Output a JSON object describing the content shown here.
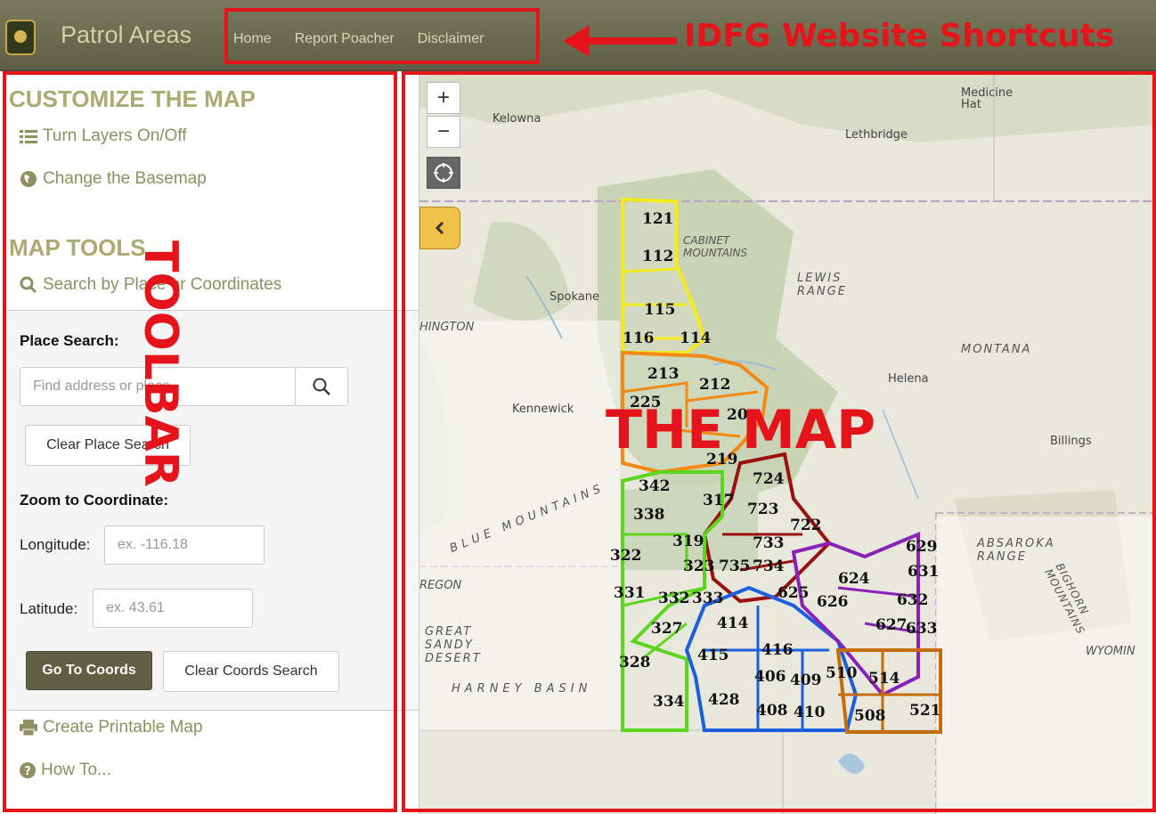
{
  "header": {
    "title": "Patrol Areas",
    "nav": [
      "Home",
      "Report Poacher",
      "Disclaimer"
    ]
  },
  "annotations": {
    "shortcuts": "IDFG Website Shortcuts",
    "toolbar": "TOOLBAR",
    "map": "THE MAP",
    "color": "#e5141a"
  },
  "sidebar": {
    "customize_heading": "CUSTOMIZE THE MAP",
    "layers_link": "Turn Layers On/Off",
    "basemap_link": "Change the Basemap",
    "tools_heading": "MAP TOOLS",
    "search_link": "Search by Place or Coordinates",
    "place_search_label": "Place Search:",
    "place_placeholder": "Find address or place",
    "clear_place": "Clear Place Search",
    "zoom_label": "Zoom to Coordinate:",
    "longitude_label": "Longitude:",
    "longitude_placeholder": "ex. -116.18",
    "latitude_label": "Latitude:",
    "latitude_placeholder": "ex. 43.61",
    "go_button": "Go To Coords",
    "clear_coords": "Clear Coords Search",
    "print_link": "Create Printable Map",
    "howto_link": "How To..."
  },
  "map": {
    "places": [
      "Kelowna",
      "Medicine Hat",
      "Lethbridge",
      "Spokane",
      "Kennewick",
      "Helena",
      "Billings",
      "MONTANA",
      "LEWIS RANGE",
      "CABINET MOUNTAINS",
      "ABSAROKA RANGE",
      "WYOMIN",
      "REGON",
      "HINGTON",
      "BIGHORN MOUNTAINS",
      "GREAT SANDY DESERT",
      "HARNEY BASIN",
      "BLUE MOUNTAINS"
    ],
    "units": [
      "121",
      "112",
      "115",
      "116",
      "114",
      "213",
      "212",
      "225",
      "20",
      "219",
      "724",
      "342",
      "317",
      "338",
      "723",
      "722",
      "319",
      "733",
      "322",
      "323",
      "735",
      "734",
      "624",
      "629",
      "631",
      "331",
      "332",
      "333",
      "625",
      "626",
      "632",
      "414",
      "627",
      "633",
      "327",
      "416",
      "415",
      "510",
      "514",
      "328",
      "406",
      "409",
      "428",
      "408",
      "410",
      "508",
      "521",
      "334"
    ],
    "zone_colors": {
      "100": "#f4ea1c",
      "200": "#f28a14",
      "300": "#5cd61c",
      "400": "#1b5fe0",
      "500": "#c56d08",
      "600": "#8a22b8",
      "700": "#9b1010"
    }
  }
}
